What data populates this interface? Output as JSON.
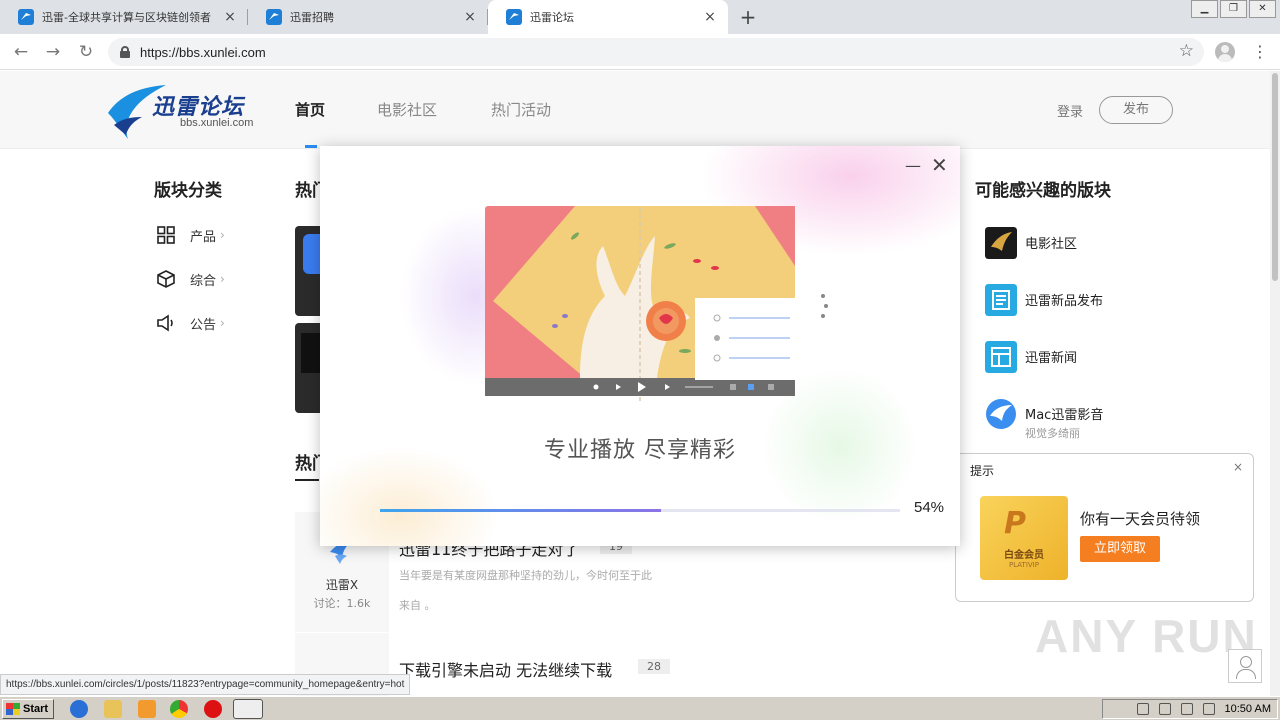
{
  "browser": {
    "tabs": [
      {
        "label": "迅雷-全球共享计算与区块链创领者"
      },
      {
        "label": "迅雷招聘"
      },
      {
        "label": "迅雷论坛"
      }
    ],
    "url": "https://bbs.xunlei.com",
    "status_url": "https://bbs.xunlei.com/circles/1/posts/11823?entrypage=community_homepage&entry=hot"
  },
  "header": {
    "logo_cn": "迅雷论坛",
    "logo_en": "bbs.xunlei.com",
    "nav": [
      "首页",
      "电影社区",
      "热门活动"
    ],
    "login": "登录",
    "publish": "发布"
  },
  "sidebar": {
    "title": "版块分类",
    "items": [
      {
        "label": "产品",
        "icon": "grid-icon"
      },
      {
        "label": "综合",
        "icon": "cube-icon"
      },
      {
        "label": "公告",
        "icon": "megaphone-icon"
      }
    ]
  },
  "main": {
    "hot_title": "热门",
    "hot_title2": "热门",
    "posts": [
      {
        "title": "迅雷11终于把路子走对了",
        "count": "19",
        "desc1": "当年要是有某度网盘那种坚持的劲儿，今时何至于此",
        "desc2": "来自 。",
        "author": "迅雷X",
        "stat": "讨论：1.6k"
      },
      {
        "title": "下载引擎未启动 无法继续下载",
        "count": "28"
      }
    ]
  },
  "right": {
    "title": "可能感兴趣的版块",
    "items": [
      {
        "label": "电影社区",
        "sub": ""
      },
      {
        "label": "迅雷新品发布",
        "sub": ""
      },
      {
        "label": "迅雷新闻",
        "sub": ""
      },
      {
        "label": "Mac迅雷影音",
        "sub": "视觉多绮丽"
      }
    ]
  },
  "tip": {
    "title": "提示",
    "close": "×",
    "card_name": "白金会员",
    "card_en": "PLATIVIP",
    "message": "你有一天会员待领",
    "button": "立即领取"
  },
  "dialog": {
    "tagline": "专业播放 尽享精彩",
    "progress_percent": 54,
    "progress_text": "54%",
    "minimize": "—",
    "close": "✕"
  },
  "watermark": "ANY RUN",
  "taskbar": {
    "start": "Start",
    "time": "10:50 AM"
  },
  "colors": {
    "accent": "#2a8cf0",
    "claim_button": "#f47e20"
  }
}
